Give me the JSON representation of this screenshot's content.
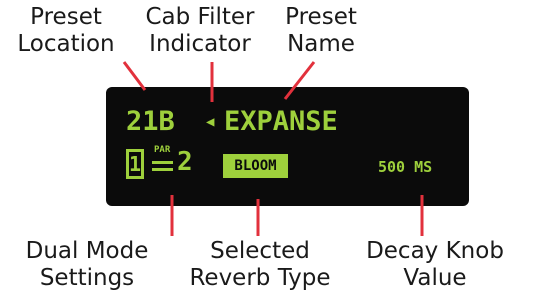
{
  "callouts": {
    "preset_location": [
      "Preset",
      "Location"
    ],
    "cab_filter": [
      "Cab Filter",
      "Indicator"
    ],
    "preset_name": [
      "Preset",
      "Name"
    ],
    "dual_mode": [
      "Dual Mode",
      "Settings"
    ],
    "reverb_type": [
      "Selected",
      "Reverb Type"
    ],
    "decay_knob": [
      "Decay Knob",
      "Value"
    ]
  },
  "display": {
    "preset_location": "21B",
    "cab_filter_icon": "speaker-icon",
    "cab_filter_glyph": "◀",
    "preset_name": "EXPANSE",
    "dual_mode_index": "1",
    "dual_mode_label": "PAR",
    "dual_mode_count": "2",
    "reverb_type": "BLOOM",
    "decay_value": "500 MS"
  },
  "colors": {
    "lcd_green": "#9ed03c",
    "screen_bg": "#0b0b0b",
    "leader_line": "#e2313c",
    "label_text": "#1a1a1a"
  }
}
